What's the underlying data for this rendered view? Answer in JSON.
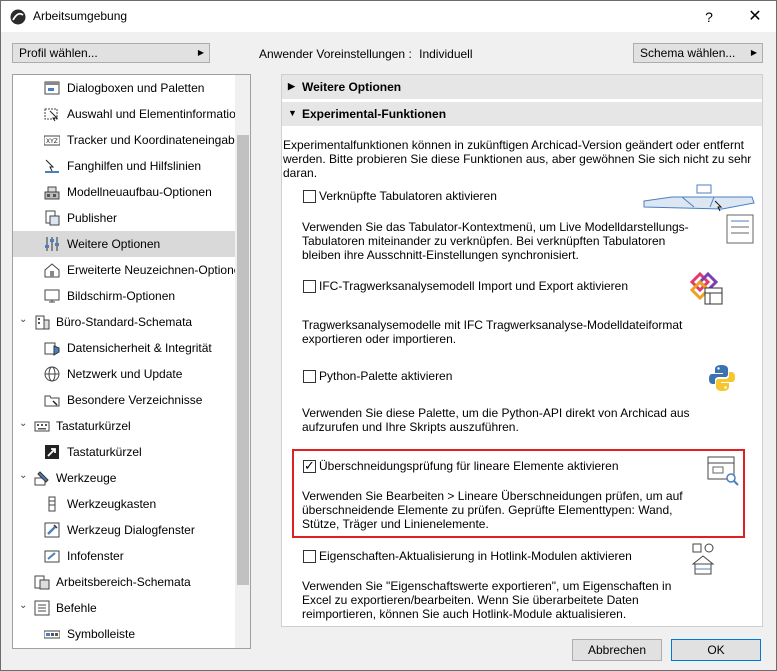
{
  "window": {
    "title": "Arbeitsumgebung",
    "help": "?",
    "close": "✕"
  },
  "toolbar": {
    "profile_button": "Profil wählen...",
    "presets_label": "Anwender Voreinstellungen :",
    "presets_value": "Individuell",
    "scheme_button": "Schema wählen..."
  },
  "tree": {
    "items": [
      {
        "label": "Dialogboxen und Paletten",
        "icon": "dialog-icon"
      },
      {
        "label": "Auswahl und Elementinformation",
        "icon": "selection-icon"
      },
      {
        "label": "Tracker und Koordinateneingabe",
        "icon": "xyz-icon"
      },
      {
        "label": "Fanghilfen und Hilfslinien",
        "icon": "snap-icon"
      },
      {
        "label": "Modellneuaufbau-Optionen",
        "icon": "rebuild-icon"
      },
      {
        "label": "Publisher",
        "icon": "publisher-icon"
      },
      {
        "label": "Weitere Optionen",
        "icon": "sliders-icon"
      },
      {
        "label": "Erweiterte Neuzeichnen-Optionen",
        "icon": "redraw-icon"
      },
      {
        "label": "Bildschirm-Optionen",
        "icon": "screen-icon"
      },
      {
        "label": "Büro-Standard-Schemata",
        "icon": "office-icon"
      },
      {
        "label": "Datensicherheit & Integrität",
        "icon": "data-safety-icon"
      },
      {
        "label": "Netzwerk und Update",
        "icon": "globe-icon"
      },
      {
        "label": "Besondere Verzeichnisse",
        "icon": "folder-icon"
      },
      {
        "label": "Tastaturkürzel",
        "icon": "keyboard-icon"
      },
      {
        "label": "Tastaturkürzel",
        "icon": "shortcut-arrow-icon"
      },
      {
        "label": "Werkzeuge",
        "icon": "tools-icon"
      },
      {
        "label": "Werkzeugkasten",
        "icon": "toolbox-icon"
      },
      {
        "label": "Werkzeug Dialogfenster",
        "icon": "tool-dialog-icon"
      },
      {
        "label": "Infofenster",
        "icon": "infobox-icon"
      },
      {
        "label": "Arbeitsbereich-Schemata",
        "icon": "workspace-icon"
      },
      {
        "label": "Befehle",
        "icon": "commands-icon"
      },
      {
        "label": "Symbolleiste",
        "icon": "toolbar-icon"
      }
    ]
  },
  "panel": {
    "section_more": "Weitere Optionen",
    "section_experimental": "Experimental-Funktionen",
    "intro": "Experimentalfunktionen können in zukünftigen Archicad-Version geändert oder entfernt werden. Bitte probieren Sie diese Funktionen aus, aber gewöhnen Sie sich nicht zu sehr daran.",
    "features": [
      {
        "label": "Verknüpfte Tabulatoren aktivieren",
        "checked": false,
        "desc": "Verwenden Sie das Tabulator-Kontextmenü, um Live Modelldarstellungs-Tabulatoren miteinander zu verknüpfen. Bei verknüpften Tabulatoren bleiben ihre Ausschnitt-Einstellungen synchronisiert."
      },
      {
        "label": "IFC-Tragwerksanalysemodell Import und Export aktivieren",
        "checked": false,
        "desc": "Tragwerksanalysemodelle mit IFC Tragwerksanalyse-Modelldateiformat exportieren oder importieren."
      },
      {
        "label": "Python-Palette aktivieren",
        "checked": false,
        "desc": "Verwenden Sie diese Palette, um die Python-API direkt von Archicad aus aufzurufen und Ihre Skripts auszuführen."
      },
      {
        "label": "Überschneidungsprüfung für lineare Elemente aktivieren",
        "checked": true,
        "desc": "Verwenden Sie Bearbeiten > Lineare Überschneidungen prüfen, um auf überschneidende Elemente zu prüfen. Geprüfte Elementtypen: Wand, Stütze, Träger und Linienelemente."
      },
      {
        "label": "Eigenschaften-Aktualisierung in Hotlink-Modulen aktivieren",
        "checked": false,
        "desc": "Verwenden Sie \"Eigenschaftswerte exportieren\", um Eigenschaften in Excel zu exportieren/bearbeiten. Wenn Sie überarbeitete Daten reimportieren, können Sie auch Hotlink-Module aktualisieren."
      }
    ]
  },
  "footer": {
    "cancel": "Abbrechen",
    "ok": "OK"
  },
  "colors": {
    "highlight": "#e02020",
    "selection": "#d9d9d9",
    "accent": "#0078d7"
  }
}
